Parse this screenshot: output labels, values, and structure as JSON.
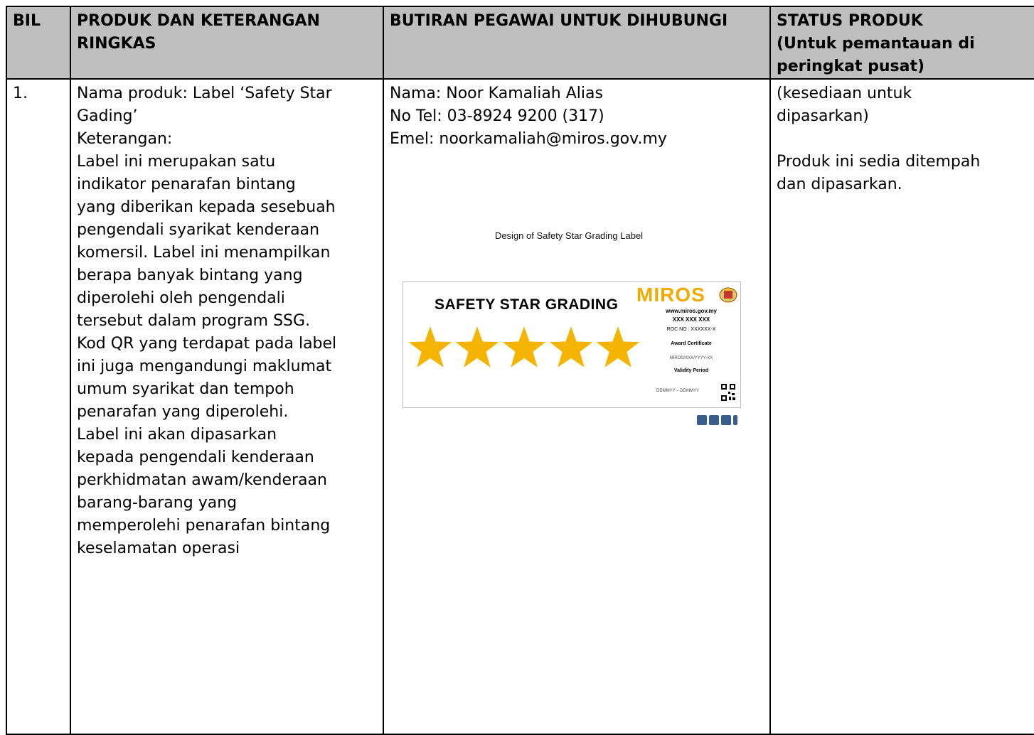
{
  "table": {
    "headers": {
      "bil": "BIL",
      "produk": [
        "PRODUK DAN KETERANGAN",
        "RINGKAS"
      ],
      "butiran": "BUTIRAN PEGAWAI UNTUK DIHUBUNGI",
      "status": [
        "STATUS PRODUK",
        "(Untuk pemantauan di",
        "peringkat pusat)"
      ]
    },
    "rows": [
      {
        "bil": "1.",
        "produk_lines": [
          "Nama produk: Label ‘Safety Star",
          "Gading’",
          "Keterangan:",
          "Label ini merupakan satu",
          "indikator penarafan bintang",
          "yang diberikan kepada sesebuah",
          "pengendali syarikat kenderaan",
          "komersil. Label ini menampilkan",
          "berapa banyak bintang yang",
          "diperolehi oleh pengendali",
          "tersebut dalam program SSG.",
          "Kod QR yang terdapat pada label",
          "ini juga mengandungi maklumat",
          "umum syarikat dan tempoh",
          "penarafan yang diperolehi.",
          "Label ini akan dipasarkan",
          "kepada pengendali kenderaan",
          "perkhidmatan awam/kenderaan",
          "barang-barang yang",
          "memperolehi penarafan bintang",
          "keselamatan operasi"
        ],
        "contact": {
          "nama": "Nama: Noor Kamaliah Alias",
          "tel": "No Tel: 03-8924 9200 (317)",
          "emel": "Emel: noorkamaliah@miros.gov.my"
        },
        "figure": {
          "caption": "Design of Safety Star Grading Label",
          "label_title": "SAFETY STAR GRADING",
          "stars": 5,
          "star_color": "#f5b400",
          "logo_text": "MIROS",
          "website": "www.miros.gov.my",
          "phone": "XXX  XXX  XXX",
          "roc": "ROC NO : XXXXXX-X",
          "award": "Award Certificate",
          "award_no": "MIROS/XXX/YYYY-XX",
          "validity": "Validity Period",
          "validity_value": "DDMMYY – DDMMYY"
        },
        "status_lines": [
          "(kesediaan untuk",
          "dipasarkan)",
          "",
          "Produk ini sedia ditempah",
          "dan dipasarkan."
        ]
      }
    ]
  }
}
